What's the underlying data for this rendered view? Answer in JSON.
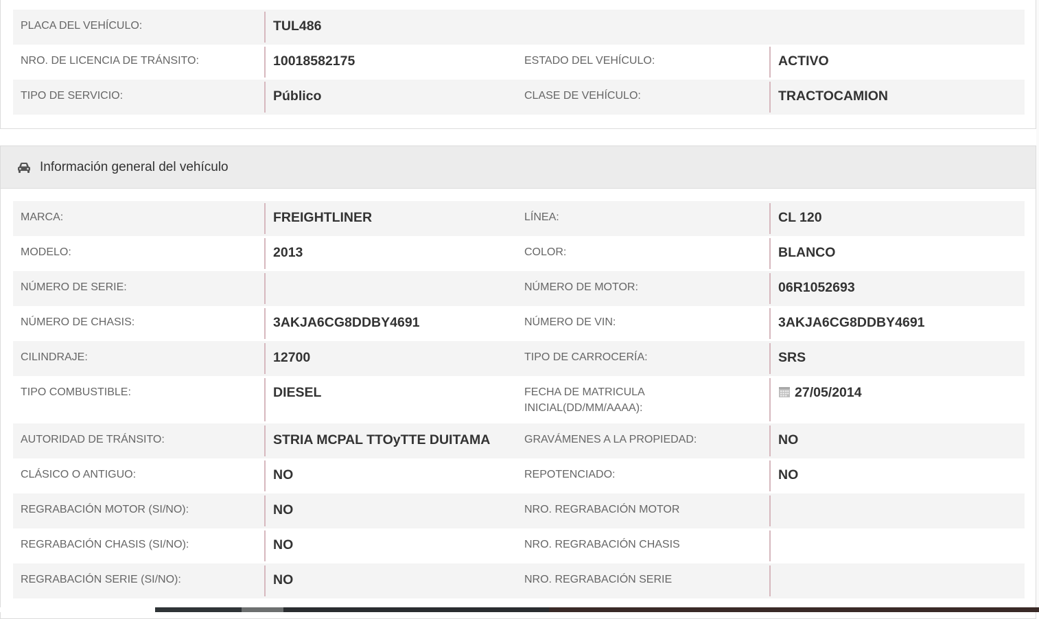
{
  "summary": {
    "rows": [
      {
        "label1": "PLACA DEL VEHÍCULO:",
        "value1": "TUL486",
        "label2": "",
        "value2": ""
      },
      {
        "label1": "NRO. DE LICENCIA DE TRÁNSITO:",
        "value1": "10018582175",
        "label2": "ESTADO DEL VEHÍCULO:",
        "value2": "ACTIVO"
      },
      {
        "label1": "TIPO DE SERVICIO:",
        "value1": "Público",
        "label2": "CLASE DE VEHÍCULO:",
        "value2": "TRACTOCAMION"
      }
    ]
  },
  "general": {
    "title": "Información general del vehículo",
    "icon": "car-icon",
    "rows": [
      {
        "label1": "MARCA:",
        "value1": "FREIGHTLINER",
        "label2": "LÍNEA:",
        "value2": "CL 120"
      },
      {
        "label1": "MODELO:",
        "value1": "2013",
        "label2": "COLOR:",
        "value2": "BLANCO"
      },
      {
        "label1": "NÚMERO DE SERIE:",
        "value1": "",
        "label2": "NÚMERO DE MOTOR:",
        "value2": "06R1052693"
      },
      {
        "label1": "NÚMERO DE CHASIS:",
        "value1": "3AKJA6CG8DDBY4691",
        "label2": "NÚMERO DE VIN:",
        "value2": "3AKJA6CG8DDBY4691"
      },
      {
        "label1": "CILINDRAJE:",
        "value1": "12700",
        "label2": "TIPO DE CARROCERÍA:",
        "value2": "SRS"
      },
      {
        "label1": "TIPO COMBUSTIBLE:",
        "value1": "DIESEL",
        "label2": "FECHA DE MATRICULA INICIAL(DD/MM/AAAA):",
        "value2": "27/05/2014"
      },
      {
        "label1": "AUTORIDAD DE TRÁNSITO:",
        "value1": "STRIA MCPAL TTOyTTE DUITAMA",
        "label2": "GRAVÁMENES A LA PROPIEDAD:",
        "value2": "NO"
      },
      {
        "label1": "CLÁSICO O ANTIGUO:",
        "value1": "NO",
        "label2": "REPOTENCIADO:",
        "value2": "NO"
      },
      {
        "label1": "REGRABACIÓN MOTOR (SI/NO):",
        "value1": "NO",
        "label2": "NRO. REGRABACIÓN MOTOR",
        "value2": ""
      },
      {
        "label1": "REGRABACIÓN CHASIS (SI/NO):",
        "value1": "NO",
        "label2": "NRO. REGRABACIÓN CHASIS",
        "value2": ""
      },
      {
        "label1": "REGRABACIÓN SERIE (SI/NO):",
        "value1": "NO",
        "label2": "NRO. REGRABACIÓN SERIE",
        "value2": ""
      }
    ]
  }
}
